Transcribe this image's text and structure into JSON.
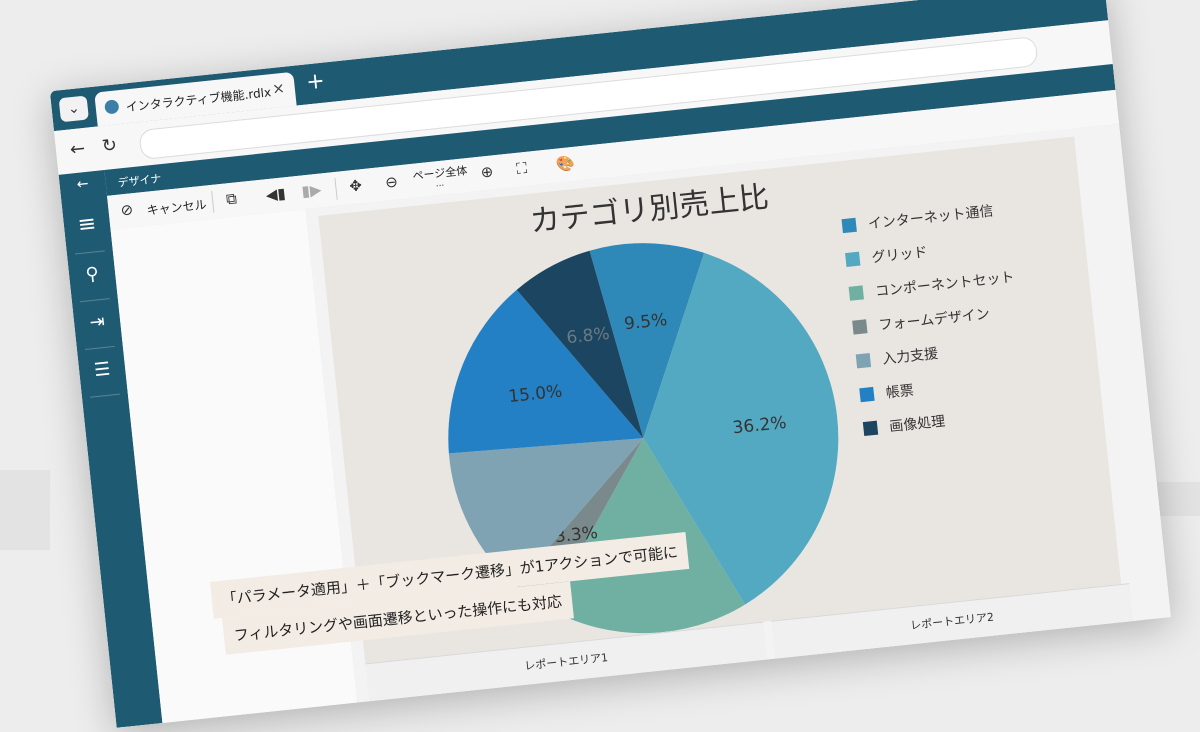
{
  "browser": {
    "tab_title": "インタラクティブ機能.rdlx",
    "new_tab": "+",
    "close": "×",
    "chevron": "⌄"
  },
  "app": {
    "title": "デザイナ",
    "toolbar": {
      "cancel_label": "キャンセル",
      "page_fit_label": "ページ全体",
      "page_fit_sub": "..."
    }
  },
  "chart_data": {
    "type": "pie",
    "title": "カテゴリ別売上比",
    "legend_position": "right",
    "series": [
      {
        "name": "インターネット通信",
        "value": 9.5,
        "color": "#2f89b8",
        "label": "9.5%"
      },
      {
        "name": "グリッド",
        "value": 36.2,
        "color": "#52a9c1",
        "label": "36.2%"
      },
      {
        "name": "コンポーネントセット",
        "value": 16.8,
        "color": "#6fb0a3",
        "label": "16.8%"
      },
      {
        "name": "フォームデザイン",
        "value": 3.3,
        "color": "#7a8a8c",
        "label": "3.3%"
      },
      {
        "name": "入力支援",
        "value": 12.4,
        "color": "#7fa3b3",
        "label": ""
      },
      {
        "name": "帳票",
        "value": 15.0,
        "color": "#2480c4",
        "label": "15.0%"
      },
      {
        "name": "画像処理",
        "value": 6.8,
        "color": "#1b4560",
        "label": "6.8%"
      }
    ]
  },
  "report_areas": {
    "area1": "レポートエリア1",
    "area2": "レポートエリア2"
  },
  "caption": {
    "line1": "「パラメータ適用」＋「ブックマーク遷移」が1アクションで可能に",
    "line2": "フィルタリングや画面遷移といった操作にも対応"
  }
}
